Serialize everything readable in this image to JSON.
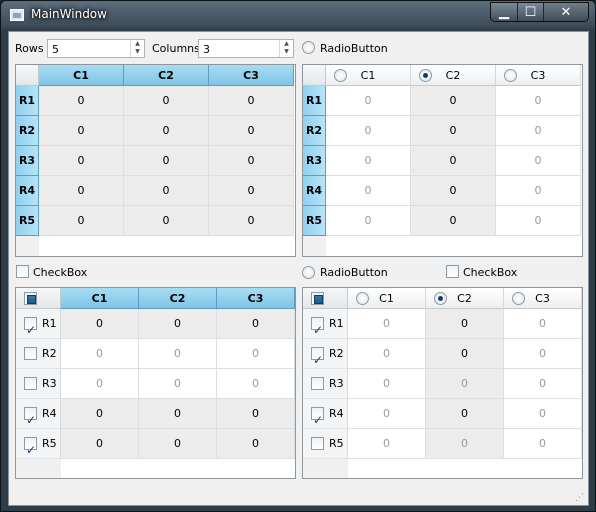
{
  "window": {
    "title": "MainWindow"
  },
  "controls": {
    "rows_label": "Rows",
    "rows_value": "5",
    "columns_label": "Columns",
    "columns_value": "3",
    "radio_top_label": "RadioButton",
    "checkbox_left_label": "CheckBox",
    "radio_bottom_label": "RadioButton",
    "checkbox_right_label": "CheckBox"
  },
  "tables": {
    "columns": [
      "C1",
      "C2",
      "C3"
    ],
    "rows": [
      "R1",
      "R2",
      "R3",
      "R4",
      "R5"
    ],
    "values": [
      [
        "0",
        "0",
        "0"
      ],
      [
        "0",
        "0",
        "0"
      ],
      [
        "0",
        "0",
        "0"
      ],
      [
        "0",
        "0",
        "0"
      ],
      [
        "0",
        "0",
        "0"
      ]
    ],
    "top_right_selected_column": "C2",
    "bottom_left_checked_rows": [
      "R1",
      "R4",
      "R5"
    ],
    "bottom_right_checked_rows": [
      "R1",
      "R2",
      "R4"
    ],
    "bottom_right_selected_column": "C2"
  }
}
